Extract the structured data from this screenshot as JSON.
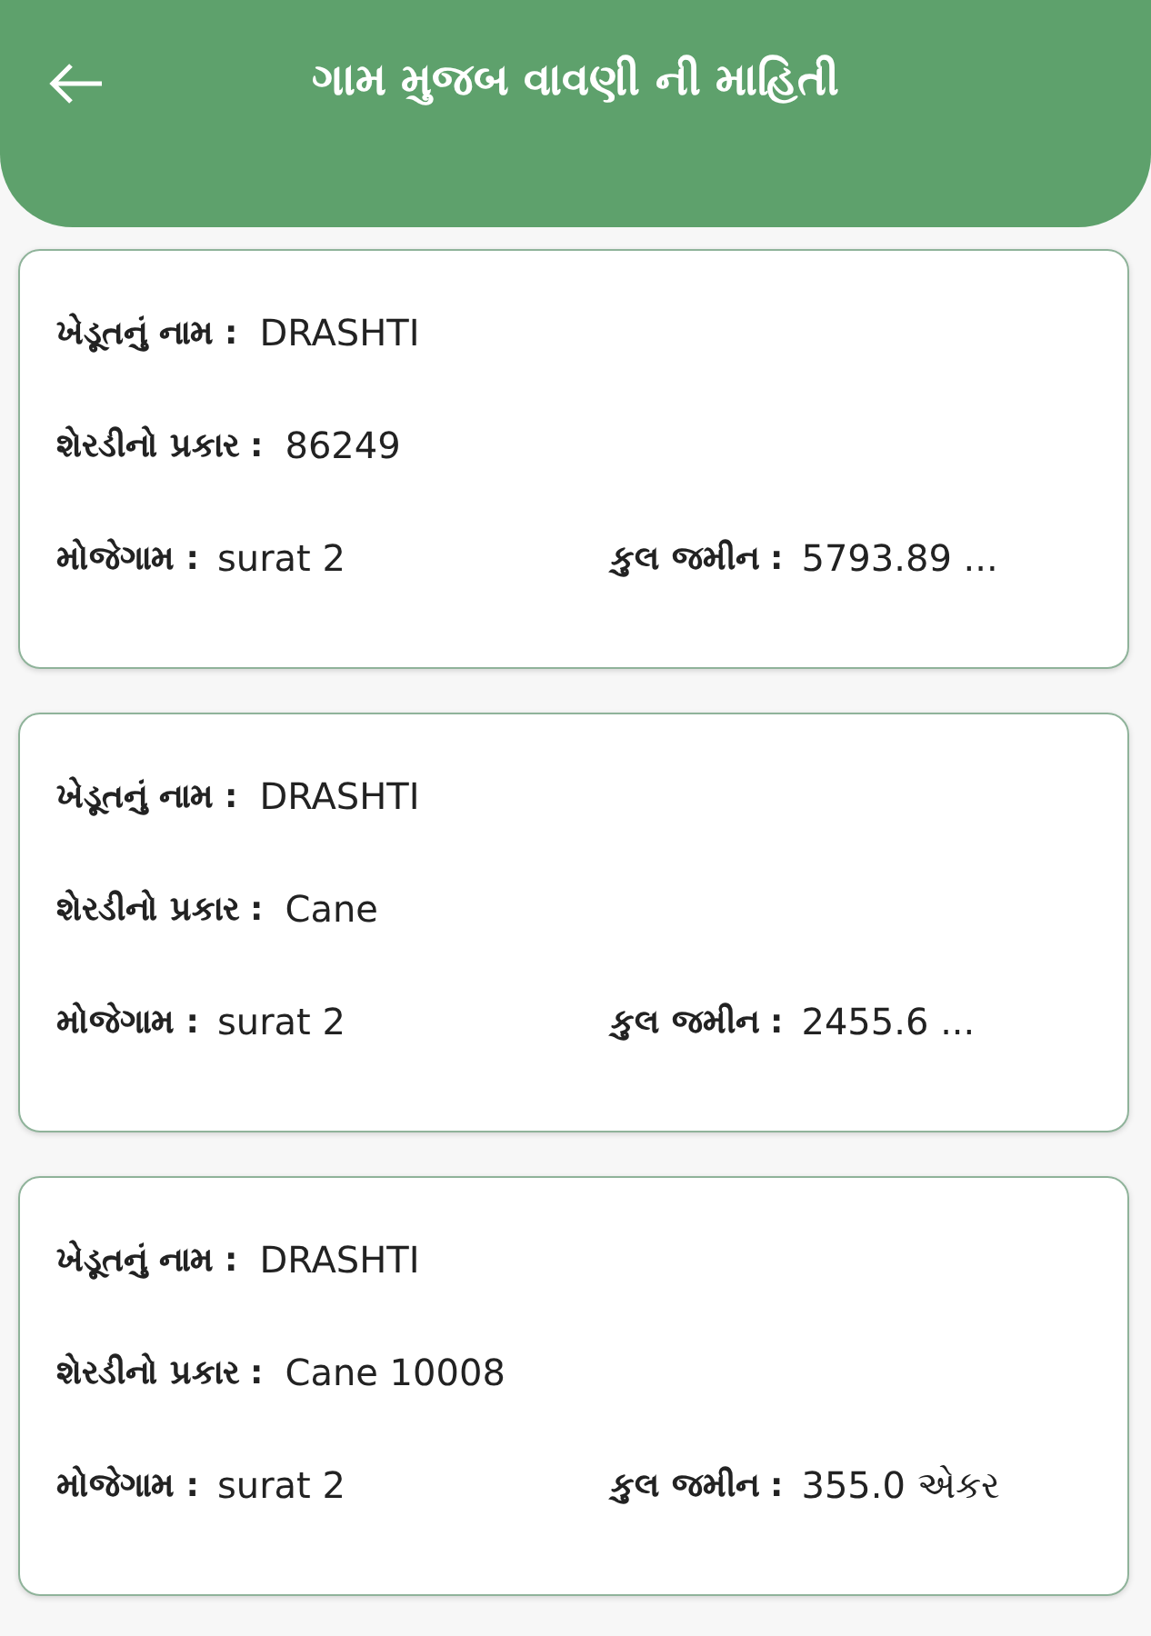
{
  "header": {
    "title": "ગામ મુજબ વાવણી ની માહિતી"
  },
  "cards": [
    {
      "farmer_label": "ખેડૂતનું નામ :",
      "farmer": "DRASHTI",
      "cane_label": "શેરડીનો પ્રકાર :",
      "cane": "86249",
      "village_label": "મોજેગામ :",
      "village": "surat 2",
      "land_label": "કુલ જમીન :",
      "land": "5793.89 ..."
    },
    {
      "farmer_label": "ખેડૂતનું નામ :",
      "farmer": "DRASHTI",
      "cane_label": "શેરડીનો પ્રકાર :",
      "cane": "Cane",
      "village_label": "મોજેગામ :",
      "village": "surat 2",
      "land_label": "કુલ જમીન :",
      "land": "2455.6 ..."
    },
    {
      "farmer_label": "ખેડૂતનું નામ :",
      "farmer": "DRASHTI",
      "cane_label": "શેરડીનો પ્રકાર :",
      "cane": "Cane 10008",
      "village_label": "મોજેગામ :",
      "village": "surat 2",
      "land_label": "કુલ જમીન :",
      "land": "355.0 એકર"
    }
  ]
}
